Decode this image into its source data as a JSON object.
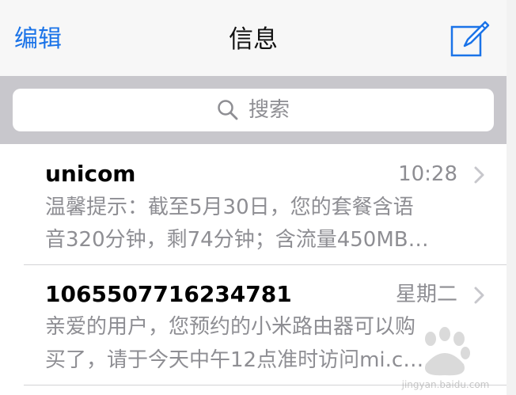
{
  "nav": {
    "edit_label": "编辑",
    "title": "信息"
  },
  "search": {
    "placeholder": "搜索"
  },
  "messages": [
    {
      "sender": "unicom",
      "time": "10:28",
      "preview_line1": "温馨提示：截至5月30日，您的套餐含语",
      "preview_line2": "音320分钟，剩74分钟；含流量450MB…"
    },
    {
      "sender": "1065507716234781",
      "time": "星期二",
      "preview_line1": "亲爱的用户，您预约的小米路由器可以购",
      "preview_line2": "买了，请于今天中午12点准时访问mi.c…"
    }
  ],
  "watermark": {
    "text": "jingyan.baidu.com"
  },
  "colors": {
    "accent": "#1a73e8",
    "secondary_text": "#8e8e93",
    "search_bar_bg": "#c8c7cc"
  },
  "icons": {
    "compose": "compose-icon",
    "search": "search-icon",
    "chevron": "chevron-right-icon"
  }
}
